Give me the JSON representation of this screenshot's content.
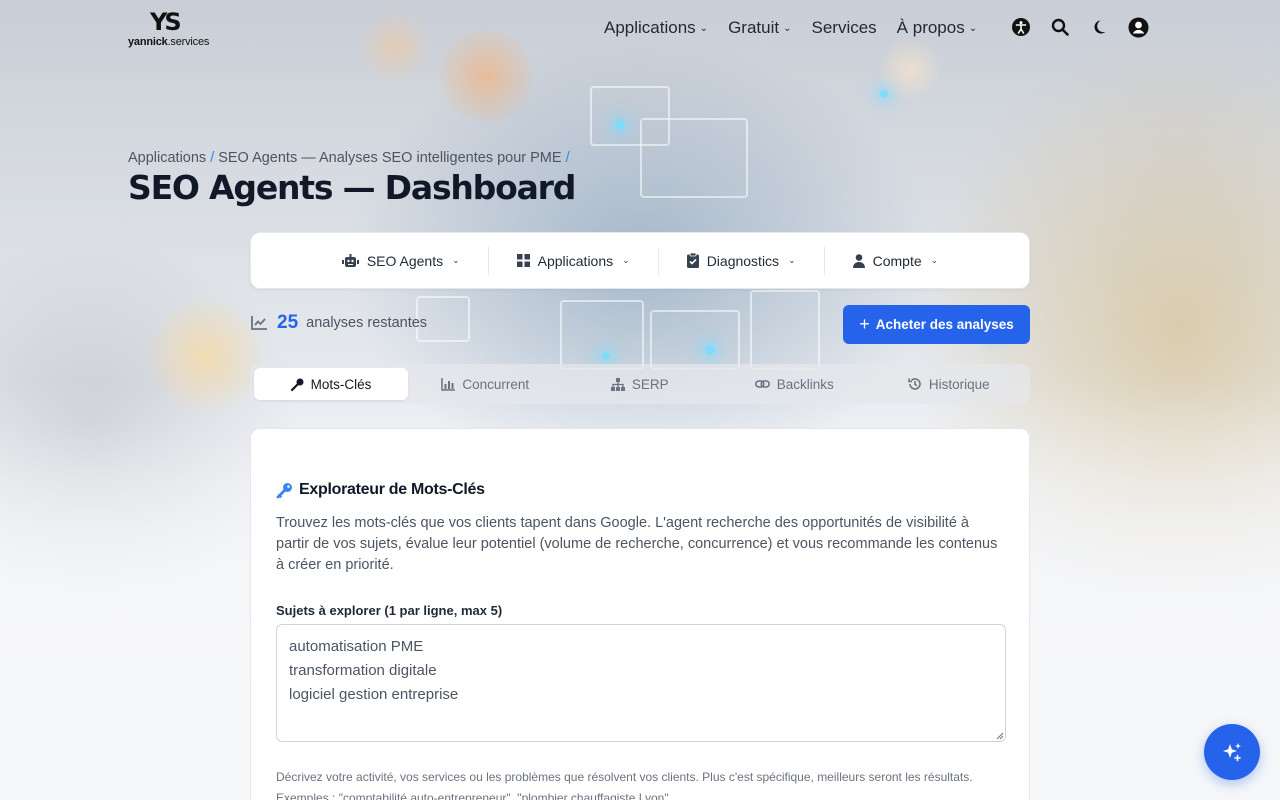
{
  "header": {
    "logo_mark": "YS",
    "logo_text_bold": "yannick",
    "logo_text_rest": ".services",
    "nav": [
      {
        "label": "Applications",
        "has_dropdown": true
      },
      {
        "label": "Gratuit",
        "has_dropdown": true
      },
      {
        "label": "Services",
        "has_dropdown": false
      },
      {
        "label": "À propos",
        "has_dropdown": true
      }
    ],
    "icons": [
      "accessibility-icon",
      "search-icon",
      "moon-icon",
      "user-circle-icon"
    ]
  },
  "breadcrumb": {
    "items": [
      "Applications",
      "SEO Agents — Analyses SEO intelligentes pour PME"
    ],
    "separator": "/"
  },
  "page_title": "SEO Agents — Dashboard",
  "subnav": {
    "items": [
      {
        "label": "SEO Agents",
        "icon": "robot-icon"
      },
      {
        "label": "Applications",
        "icon": "grid-icon"
      },
      {
        "label": "Diagnostics",
        "icon": "clipboard-check-icon"
      },
      {
        "label": "Compte",
        "icon": "user-icon"
      }
    ]
  },
  "stats": {
    "count": "25",
    "label": "analyses restantes"
  },
  "buy_button": {
    "label": "Acheter des analyses"
  },
  "tabs": [
    {
      "label": "Mots-Clés",
      "icon": "key-icon",
      "active": true
    },
    {
      "label": "Concurrent",
      "icon": "chart-icon",
      "active": false
    },
    {
      "label": "SERP",
      "icon": "sitemap-icon",
      "active": false
    },
    {
      "label": "Backlinks",
      "icon": "link-icon",
      "active": false
    },
    {
      "label": "Historique",
      "icon": "history-icon",
      "active": false
    }
  ],
  "card": {
    "title": "Explorateur de Mots-Clés",
    "description": "Trouvez les mots-clés que vos clients tapent dans Google. L'agent recherche des opportunités de visibilité à partir de vos sujets, évalue leur potentiel (volume de recherche, concurrence) et vous recommande les contenus à créer en priorité.",
    "field_label": "Sujets à explorer (1 par ligne, max 5)",
    "textarea_value": "automatisation PME\ntransformation digitale\nlogiciel gestion entreprise",
    "hint": "Décrivez votre activité, vos services ou les problèmes que résolvent vos clients. Plus c'est spécifique, meilleurs seront les résultats. Exemples : \"comptabilité auto-entrepreneur\", \"plombier chauffagiste Lyon\"."
  },
  "colors": {
    "accent": "#2563eb",
    "title": "#111827",
    "muted": "#4b5563"
  }
}
